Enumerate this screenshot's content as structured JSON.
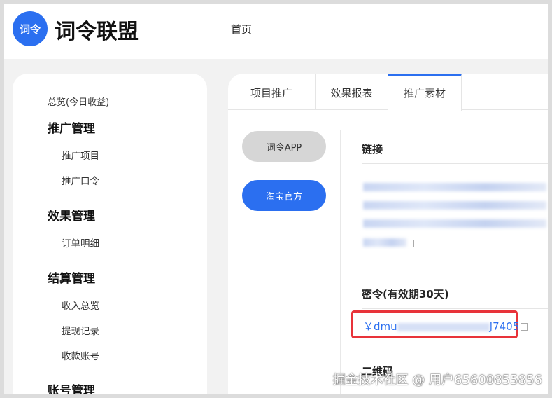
{
  "header": {
    "logo_text": "词令",
    "brand": "词令联盟",
    "nav_home": "首页"
  },
  "sidebar": {
    "overview": "总览(今日收益)",
    "groups": [
      {
        "title": "推广管理",
        "items": [
          "推广项目",
          "推广口令"
        ]
      },
      {
        "title": "效果管理",
        "items": [
          "订单明细"
        ]
      },
      {
        "title": "结算管理",
        "items": [
          "收入总览",
          "提现记录",
          "收款账号"
        ]
      },
      {
        "title": "账号管理",
        "items": []
      }
    ]
  },
  "tabs": [
    "项目推广",
    "效果报表",
    "推广素材"
  ],
  "active_tab": "推广素材",
  "buttons": {
    "app": "词令APP",
    "taobao": "淘宝官方"
  },
  "sections": {
    "link": "链接",
    "password": "密令(有效期30天)",
    "qrcode": "二维码"
  },
  "password": {
    "prefix": "￥dmu",
    "suffix": "J7405"
  },
  "watermark": "掘金技术社区 @ 用户65600855856",
  "colors": {
    "accent": "#2b6ff0",
    "highlight": "#e8333a"
  }
}
